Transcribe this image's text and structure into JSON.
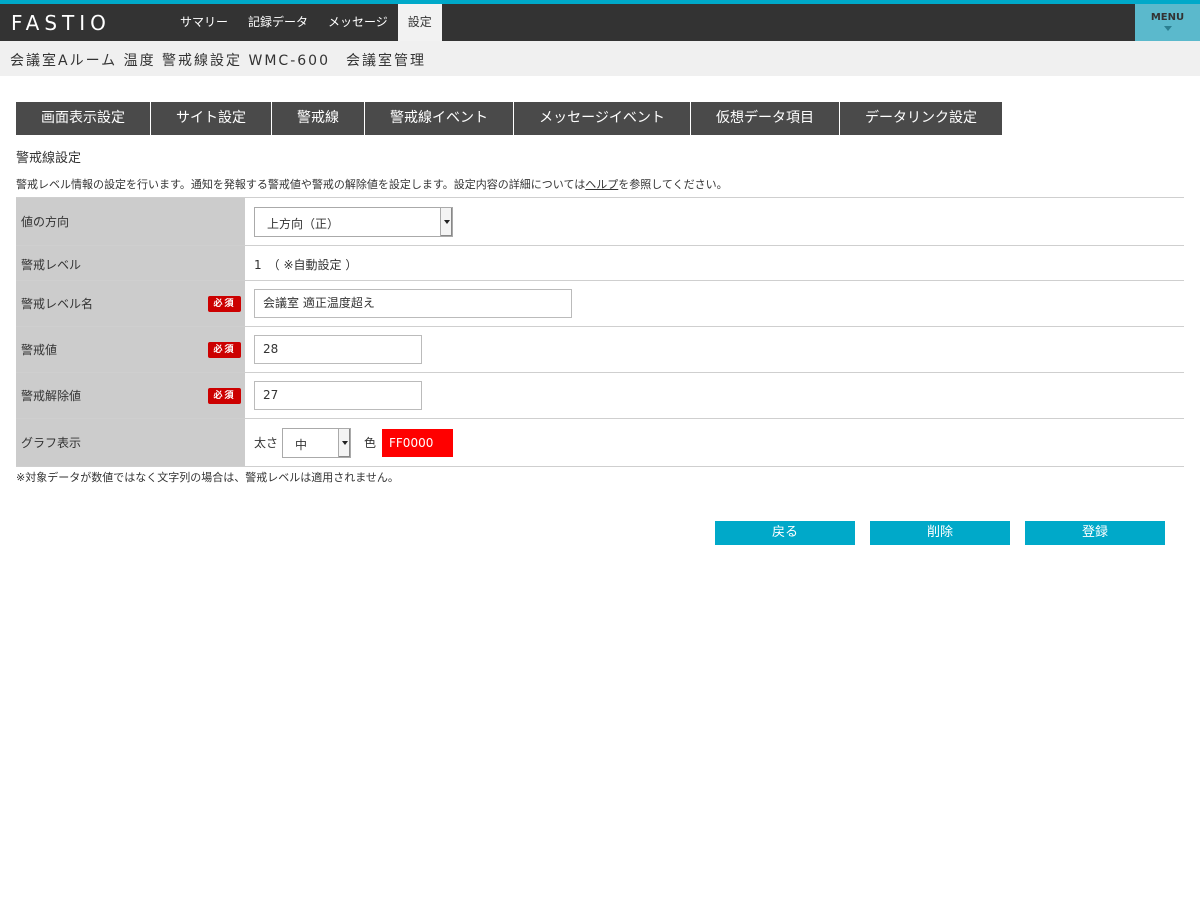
{
  "header": {
    "logo": "FASTIO",
    "nav": [
      {
        "label": "サマリー"
      },
      {
        "label": "記録データ"
      },
      {
        "label": "メッセージ"
      },
      {
        "label": "設定"
      }
    ],
    "active_nav": "設定",
    "menu_label": "MENU"
  },
  "breadcrumb": "会議室Aルーム 温度 警戒線設定 WMC-600　会議室管理",
  "tabs": [
    {
      "label": "画面表示設定"
    },
    {
      "label": "サイト設定"
    },
    {
      "label": "警戒線"
    },
    {
      "label": "警戒線イベント"
    },
    {
      "label": "メッセージイベント"
    },
    {
      "label": "仮想データ項目"
    },
    {
      "label": "データリンク設定"
    }
  ],
  "section_title": "警戒線設定",
  "description": {
    "before": "警戒レベル情報の設定を行います。通知を発報する警戒値や警戒の解除値を設定します。設定内容の詳細については",
    "link": "ヘルプ",
    "after": "を参照してください。"
  },
  "required_label": "必須",
  "form": {
    "direction": {
      "label": "値の方向",
      "value": "上方向（正）"
    },
    "level": {
      "label": "警戒レベル",
      "value": "1　（ ※自動設定 ）"
    },
    "level_name": {
      "label": "警戒レベル名",
      "value": "会議室 適正温度超え"
    },
    "alarm_value": {
      "label": "警戒値",
      "value": "28"
    },
    "release_value": {
      "label": "警戒解除値",
      "value": "27"
    },
    "graph": {
      "label": "グラフ表示",
      "thickness_label": "太さ",
      "thickness_value": "中",
      "color_label": "色",
      "color_value": "FF0000"
    }
  },
  "note": "※対象データが数値ではなく文字列の場合は、警戒レベルは適用されません。",
  "buttons": {
    "back": "戻る",
    "delete": "削除",
    "register": "登録"
  },
  "colors": {
    "accent": "#00a9c9",
    "header_bg": "#333333",
    "required": "#cc0000",
    "graph_color": "#FF0000"
  }
}
